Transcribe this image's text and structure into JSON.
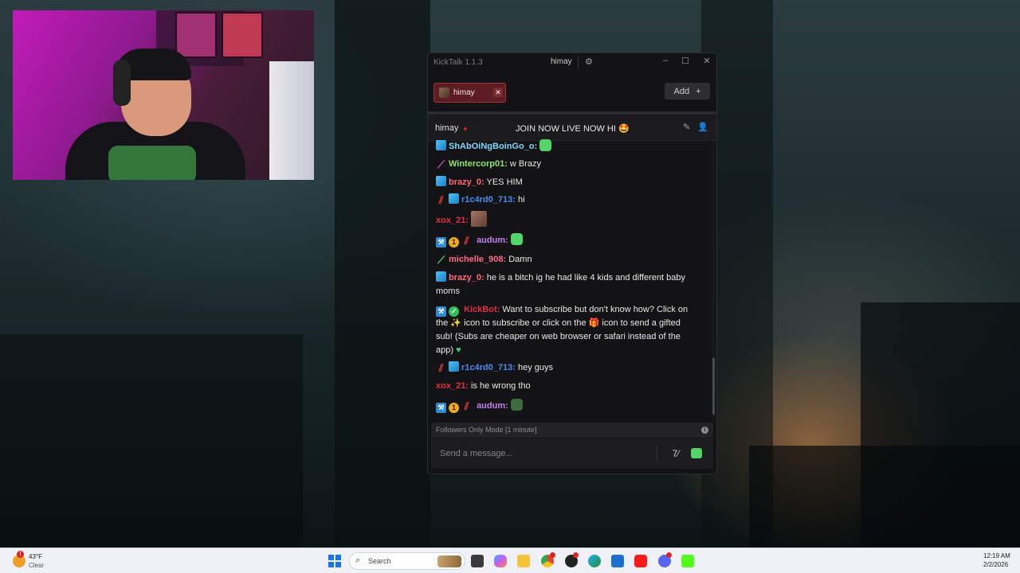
{
  "desktop": {
    "webcam_label": "streamer webcam"
  },
  "kicktalk": {
    "app_title": "KickTalk 1.1.3",
    "title_user": "himay",
    "window_controls": {
      "minimize": "–",
      "maximize": "☐",
      "close": "✕"
    },
    "tab": {
      "name": "himay",
      "close": "✕"
    },
    "add_button": {
      "label": "Add",
      "icon": "+"
    },
    "chat_header": {
      "channel": "himay",
      "stream_title": "JOIN NOW LIVE NOW HI 🤩"
    },
    "messages": [
      {
        "user": "ShAbOiNgBoinGo_o:",
        "text": "",
        "color": "#7fd8ff"
      },
      {
        "user": "Wintercorp01:",
        "text": "w Brazy",
        "color": "#8ee86a"
      },
      {
        "user": "brazy_0:",
        "text": "YES HIM",
        "color": "#ff6b7a"
      },
      {
        "user": "r1c4rd0_713:",
        "text": "hi",
        "color": "#4a8cf0"
      },
      {
        "user": "xox_21:",
        "text": "",
        "color": "#e0304a"
      },
      {
        "user": "audum:",
        "text": "",
        "color": "#c27ef0"
      },
      {
        "user": "michelle_908:",
        "text": "Damn",
        "color": "#ff6b8a"
      },
      {
        "user": "brazy_0:",
        "text": "he is a bitch ig he had like 4 kids and different baby moms",
        "color": "#ff6b7a"
      },
      {
        "user": "KickBot:",
        "text_a": "Want to subscribe but don't know how? Click on the",
        "text_b": "icon to subscribe or click on the",
        "text_c": "icon to send a gifted sub! (Subs are cheaper on web browser or safari instead of the app)",
        "color": "#e0304a"
      },
      {
        "user": "r1c4rd0_713:",
        "text": "hey guys",
        "color": "#4a8cf0"
      },
      {
        "user": "xox_21:",
        "text": "is he wrong tho",
        "color": "#e0304a"
      },
      {
        "user": "audum:",
        "text": "",
        "color": "#c27ef0"
      }
    ],
    "followers_mode": "Followers Only Mode [1 minute]",
    "input_placeholder": "Send a message..."
  },
  "taskbar": {
    "weather_temp": "43°F",
    "weather_condition": "Clear",
    "search_label": "Search",
    "clock_time": "12:19 AM",
    "clock_date": "2/2/2026",
    "apps": [
      "file-explorer-icon",
      "copilot-icon",
      "folder-icon",
      "chrome-icon",
      "obs-icon",
      "edge-icon",
      "store-icon",
      "youtube-icon",
      "discord-icon",
      "kick-icon"
    ]
  }
}
